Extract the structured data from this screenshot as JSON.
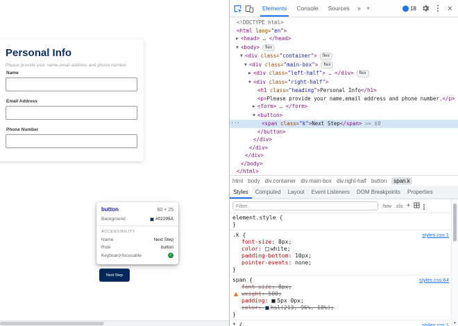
{
  "page": {
    "heading": "Personal Info",
    "description": "Please provide your name,email address and phone number.",
    "fields": [
      {
        "label": "Name",
        "value": ""
      },
      {
        "label": "Email Address",
        "value": ""
      },
      {
        "label": "Phone Number",
        "value": ""
      }
    ],
    "next_button": "Next Step",
    "button_color": "#02295A"
  },
  "inspect_tooltip": {
    "element_name": "button",
    "dimensions": "60 × 25",
    "background_label": "Background",
    "background_hex": "#02295A",
    "section_title": "ACCESSIBILITY",
    "rows": [
      {
        "label": "Name",
        "value": "Next Step"
      },
      {
        "label": "Role",
        "value": "button"
      },
      {
        "label": "Keyboard-focusable",
        "value": "",
        "check": true
      }
    ]
  },
  "devtools": {
    "toolbar": {
      "tabs": [
        {
          "label": "Elements",
          "selected": true
        },
        {
          "label": "Console",
          "selected": false
        },
        {
          "label": "Sources",
          "selected": false
        }
      ],
      "more_tabs": "»",
      "add_tab": "+",
      "issues_count": "18",
      "close_glyph": "×"
    },
    "tree": [
      {
        "indent": 0,
        "tokens": [
          {
            "c": "gray",
            "t": "<!DOCTYPE html>"
          }
        ]
      },
      {
        "indent": 0,
        "tokens": [
          {
            "c": "tag",
            "t": "<html"
          },
          {
            "c": "attr",
            "t": " lang="
          },
          {
            "c": "str",
            "t": "\"en\""
          },
          {
            "c": "tag",
            "t": ">"
          }
        ]
      },
      {
        "indent": 1,
        "arrow": "right",
        "tokens": [
          {
            "c": "tag",
            "t": "<head>"
          },
          {
            "c": "gray",
            "t": " … "
          },
          {
            "c": "tag",
            "t": "</head>"
          }
        ]
      },
      {
        "indent": 1,
        "arrow": "down",
        "badge": "flex",
        "tokens": [
          {
            "c": "tag",
            "t": "<body>"
          }
        ]
      },
      {
        "indent": 2,
        "arrow": "down",
        "badge": "flex",
        "tokens": [
          {
            "c": "tag",
            "t": "<div"
          },
          {
            "c": "attr",
            "t": " class="
          },
          {
            "c": "str",
            "t": "\"container\""
          },
          {
            "c": "tag",
            "t": ">"
          }
        ]
      },
      {
        "indent": 3,
        "arrow": "down",
        "badge": "flex",
        "tokens": [
          {
            "c": "tag",
            "t": "<div"
          },
          {
            "c": "attr",
            "t": " class="
          },
          {
            "c": "str",
            "t": "\"main-box\""
          },
          {
            "c": "tag",
            "t": ">"
          }
        ]
      },
      {
        "indent": 4,
        "arrow": "right",
        "badge": "flex",
        "tokens": [
          {
            "c": "tag",
            "t": "<div"
          },
          {
            "c": "attr",
            "t": " class="
          },
          {
            "c": "str",
            "t": "\"left-half\""
          },
          {
            "c": "tag",
            "t": ">"
          },
          {
            "c": "gray",
            "t": " … "
          },
          {
            "c": "tag",
            "t": "</div>"
          }
        ]
      },
      {
        "indent": 4,
        "arrow": "down",
        "tokens": [
          {
            "c": "tag",
            "t": "<div"
          },
          {
            "c": "attr",
            "t": " class="
          },
          {
            "c": "str",
            "t": "\"right-half\""
          },
          {
            "c": "tag",
            "t": ">"
          }
        ]
      },
      {
        "indent": 5,
        "tokens": [
          {
            "c": "tag",
            "t": "<h1"
          },
          {
            "c": "attr",
            "t": " class="
          },
          {
            "c": "str",
            "t": "\"heading\""
          },
          {
            "c": "tag",
            "t": ">"
          },
          {
            "c": "plain",
            "t": "Personal Info"
          },
          {
            "c": "tag",
            "t": "</h1>"
          }
        ]
      },
      {
        "indent": 5,
        "tokens": [
          {
            "c": "tag",
            "t": "<p>"
          },
          {
            "c": "plain",
            "t": "Please provide your name,email address and phone number."
          },
          {
            "c": "tag",
            "t": "</p>"
          }
        ]
      },
      {
        "indent": 5,
        "arrow": "right",
        "tokens": [
          {
            "c": "tag",
            "t": "<form>"
          },
          {
            "c": "gray",
            "t": " … "
          },
          {
            "c": "tag",
            "t": "</form>"
          }
        ]
      },
      {
        "indent": 5,
        "arrow": "down",
        "tokens": [
          {
            "c": "tag",
            "t": "<button>"
          }
        ]
      },
      {
        "indent": 6,
        "selected": true,
        "gutter": true,
        "tokens": [
          {
            "c": "tag",
            "t": "<span"
          },
          {
            "c": "attr",
            "t": " class="
          },
          {
            "c": "str",
            "t": "\"k\""
          },
          {
            "c": "tag",
            "t": ">"
          },
          {
            "c": "plain",
            "t": "Next Step"
          },
          {
            "c": "tag",
            "t": "</span>"
          },
          {
            "c": "eq",
            "t": " == $0"
          }
        ]
      },
      {
        "indent": 5,
        "tokens": [
          {
            "c": "tag",
            "t": "</button>"
          }
        ]
      },
      {
        "indent": 4,
        "tokens": [
          {
            "c": "tag",
            "t": "</div>"
          }
        ]
      },
      {
        "indent": 3,
        "tokens": [
          {
            "c": "tag",
            "t": "</div>"
          }
        ]
      },
      {
        "indent": 2,
        "tokens": [
          {
            "c": "tag",
            "t": "</div>"
          }
        ]
      },
      {
        "indent": 1,
        "tokens": [
          {
            "c": "tag",
            "t": "</body>"
          }
        ]
      },
      {
        "indent": 0,
        "tokens": [
          {
            "c": "tag",
            "t": "</html>"
          }
        ]
      }
    ],
    "breadcrumbs": [
      {
        "label": "html"
      },
      {
        "label": "body"
      },
      {
        "label": "div.container"
      },
      {
        "label": "div.main-box"
      },
      {
        "label": "div.right-half"
      },
      {
        "label": "button"
      },
      {
        "label": "span.k",
        "selected": true
      }
    ],
    "sidebar_tabs": [
      {
        "label": "Styles",
        "selected": true
      },
      {
        "label": "Computed"
      },
      {
        "label": "Layout"
      },
      {
        "label": "Event Listeners"
      },
      {
        "label": "DOM Breakpoints"
      },
      {
        "label": "Properties"
      }
    ],
    "filter": {
      "placeholder": "Filter",
      "hov": ":hov",
      "cls": ".cls",
      "add": "+"
    },
    "styles": [
      {
        "selector": "element.style",
        "link": "",
        "close": true,
        "props": []
      },
      {
        "selector": ".k",
        "link": "styles.css:1",
        "close": true,
        "props": [
          {
            "name": "font-size",
            "value": "8px"
          },
          {
            "name": "color",
            "value": "white",
            "swatch": "#ffffff"
          },
          {
            "name": "padding-bottom",
            "value": "10px"
          },
          {
            "name": "pointer-events",
            "value": "none"
          }
        ]
      },
      {
        "selector": "span",
        "link": "styles.css:64",
        "close": true,
        "props": [
          {
            "name": "font-size",
            "value": "8px",
            "struck": true
          },
          {
            "name": "weight",
            "value": "500",
            "struck": true,
            "warn": true
          },
          {
            "name": "padding",
            "value": "5px 0px",
            "swatch": "#1a1a1a"
          },
          {
            "name": "color",
            "value": "hsl(213, 96%, 18%)",
            "swatch": "#02295a",
            "struck": true
          }
        ]
      },
      {
        "selector": "*",
        "link": "styles.css:1",
        "close": false,
        "props": []
      }
    ]
  }
}
